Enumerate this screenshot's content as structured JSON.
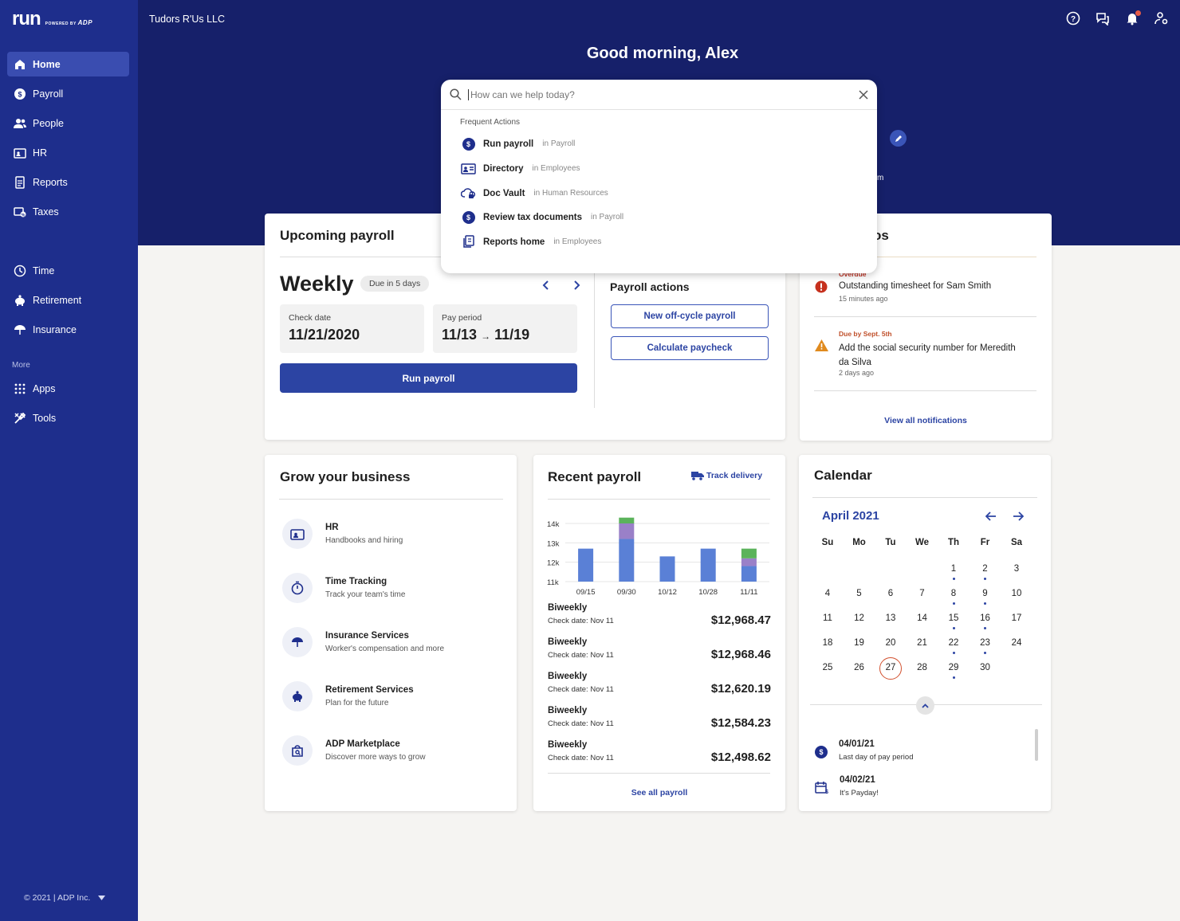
{
  "brand": {
    "run": "run",
    "powered_by": "POWERED BY",
    "adp": "ADP"
  },
  "company": "Tudors R'Us LLC",
  "greeting": "Good morning, Alex",
  "nav": {
    "items": [
      {
        "label": "Home"
      },
      {
        "label": "Payroll"
      },
      {
        "label": "People"
      },
      {
        "label": "HR"
      },
      {
        "label": "Reports"
      },
      {
        "label": "Taxes"
      },
      {
        "label": "Time"
      },
      {
        "label": "Retirement"
      },
      {
        "label": "Insurance"
      }
    ],
    "more_label": "More",
    "more_items": [
      {
        "label": "Apps"
      },
      {
        "label": "Tools"
      }
    ],
    "footer": "© 2021 | ADP Inc."
  },
  "search": {
    "placeholder": "How can we help today?",
    "frequent_label": "Frequent Actions",
    "actions": [
      {
        "name": "Run payroll",
        "context": "in Payroll",
        "icon": "dollar-icon"
      },
      {
        "name": "Directory",
        "context": "in Employees",
        "icon": "id-card-icon"
      },
      {
        "name": "Doc Vault",
        "context": "in Human Resources",
        "icon": "cloud-lock-icon"
      },
      {
        "name": "Review tax documents",
        "context": "in Payroll",
        "icon": "dollar-icon"
      },
      {
        "name": "Reports home",
        "context": "in Employees",
        "icon": "documents-icon"
      }
    ]
  },
  "upcoming": {
    "title": "Upcoming payroll",
    "frequency": "Weekly",
    "due": "Due in 5 days",
    "check_label": "Check date",
    "check_date": "11/21/2020",
    "period_label": "Pay period",
    "period_start": "11/13",
    "period_arrow": "→",
    "period_end": "11/19",
    "run_button": "Run payroll",
    "actions_title": "Payroll actions",
    "offcycle": "New off-cycle payroll",
    "calculate": "Calculate paycheck"
  },
  "notifications": {
    "title_fragment": "os",
    "items": [
      {
        "tag": "Overdue",
        "text": "Outstanding timesheet for Sam Smith",
        "time": "15 minutes ago"
      },
      {
        "tag": "Due by Sept. 5th",
        "text1": "Add the social security number for Meredith",
        "text2": "da Silva",
        "time": "2 days ago"
      }
    ],
    "view_all": "View all notifications"
  },
  "hero_fragment": "m",
  "grow": {
    "title": "Grow your business",
    "items": [
      {
        "title": "HR",
        "sub": "Handbooks and hiring"
      },
      {
        "title": "Time Tracking",
        "sub": "Track your team's time"
      },
      {
        "title": "Insurance Services",
        "sub": "Worker's compensation and more"
      },
      {
        "title": "Retirement Services",
        "sub": "Plan for the future"
      },
      {
        "title": "ADP Marketplace",
        "sub": "Discover more ways to grow"
      }
    ]
  },
  "recent": {
    "title": "Recent payroll",
    "track": "Track delivery",
    "rows": [
      {
        "freq": "Biweekly",
        "check": "Check date: Nov 11",
        "amount": "$12,968.47"
      },
      {
        "freq": "Biweekly",
        "check": "Check date: Nov 11",
        "amount": "$12,968.46"
      },
      {
        "freq": "Biweekly",
        "check": "Check date: Nov 11",
        "amount": "$12,620.19"
      },
      {
        "freq": "Biweekly",
        "check": "Check date: Nov 11",
        "amount": "$12,584.23"
      },
      {
        "freq": "Biweekly",
        "check": "Check date: Nov 11",
        "amount": "$12,498.62"
      }
    ],
    "see_all": "See all payroll"
  },
  "chart_data": {
    "type": "bar",
    "categories": [
      "09/15",
      "09/30",
      "10/12",
      "10/28",
      "11/11"
    ],
    "yticks": [
      "14k",
      "13k",
      "12k",
      "11k"
    ],
    "ylim": [
      11000,
      14000
    ],
    "colors": [
      "#5a80d6",
      "#9a80c8",
      "#5bb35b"
    ],
    "series": [
      {
        "values": [
          12700,
          13200,
          12300,
          12700,
          11800
        ]
      },
      {
        "values": [
          0,
          800,
          0,
          0,
          400
        ]
      },
      {
        "values": [
          0,
          300,
          0,
          0,
          500
        ]
      }
    ]
  },
  "calendar": {
    "title": "Calendar",
    "month": "April 2021",
    "weekdays": [
      "Su",
      "Mo",
      "Tu",
      "We",
      "Th",
      "Fr",
      "Sa"
    ],
    "first_weekday": 4,
    "days": 30,
    "today": 27,
    "dot_days": [
      1,
      2,
      8,
      9,
      15,
      16,
      22,
      23,
      29
    ],
    "events": [
      {
        "date": "04/01/21",
        "desc": "Last day of pay period",
        "icon": "dollar-icon"
      },
      {
        "date": "04/02/21",
        "desc": "It's Payday!",
        "icon": "calendar-dollar-icon"
      }
    ]
  }
}
